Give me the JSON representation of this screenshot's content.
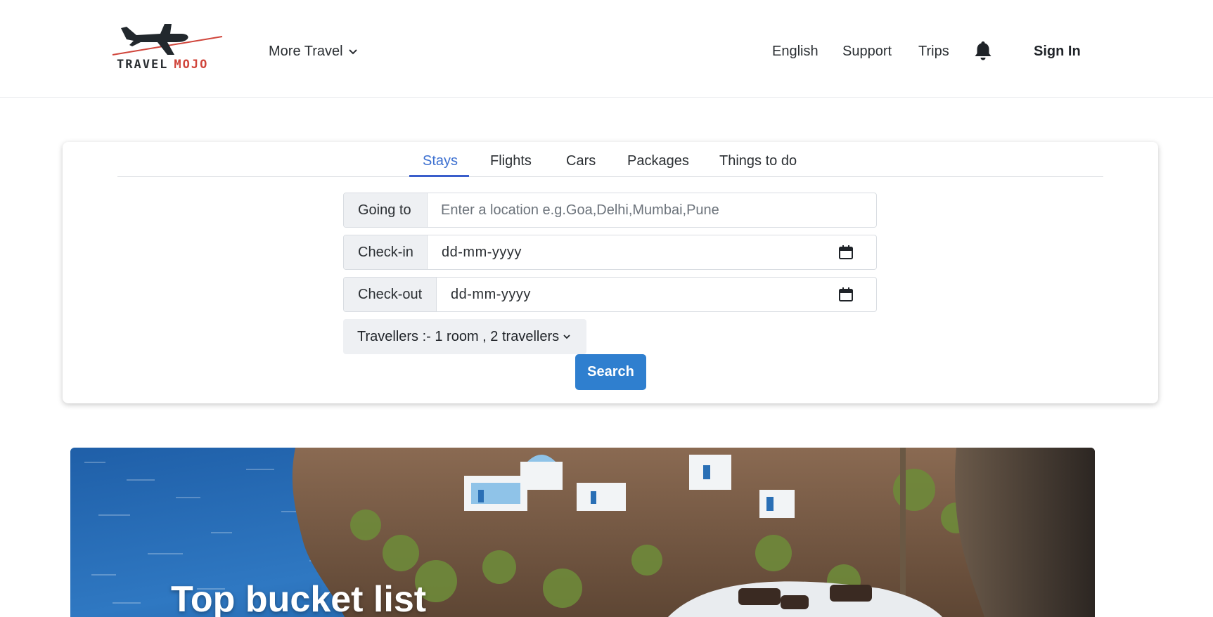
{
  "brand": {
    "logo_word1": "TRAVEL",
    "logo_word2": "MOJO",
    "accent_color": "#d0453b"
  },
  "header": {
    "more_travel": "More Travel",
    "nav": {
      "english": "English",
      "support": "Support",
      "trips": "Trips"
    },
    "sign_in": "Sign In"
  },
  "search": {
    "tabs": [
      {
        "label": "Stays",
        "active": true
      },
      {
        "label": "Flights",
        "active": false
      },
      {
        "label": "Cars",
        "active": false
      },
      {
        "label": "Packages",
        "active": false
      },
      {
        "label": "Things to do",
        "active": false
      }
    ],
    "going_to": {
      "label": "Going to",
      "placeholder": "Enter a location e.g.Goa,Delhi,Mumbai,Pune"
    },
    "check_in": {
      "label": "Check-in",
      "value": "dd-mm-yyyy"
    },
    "check_out": {
      "label": "Check-out",
      "value": "dd-mm-yyyy"
    },
    "travellers": "Travellers :- 1 room , 2 travellers",
    "search_button": "Search",
    "button_color": "#2f7fcf",
    "active_tab_color": "#3b6fd0"
  },
  "hero": {
    "title": "Top bucket list"
  }
}
